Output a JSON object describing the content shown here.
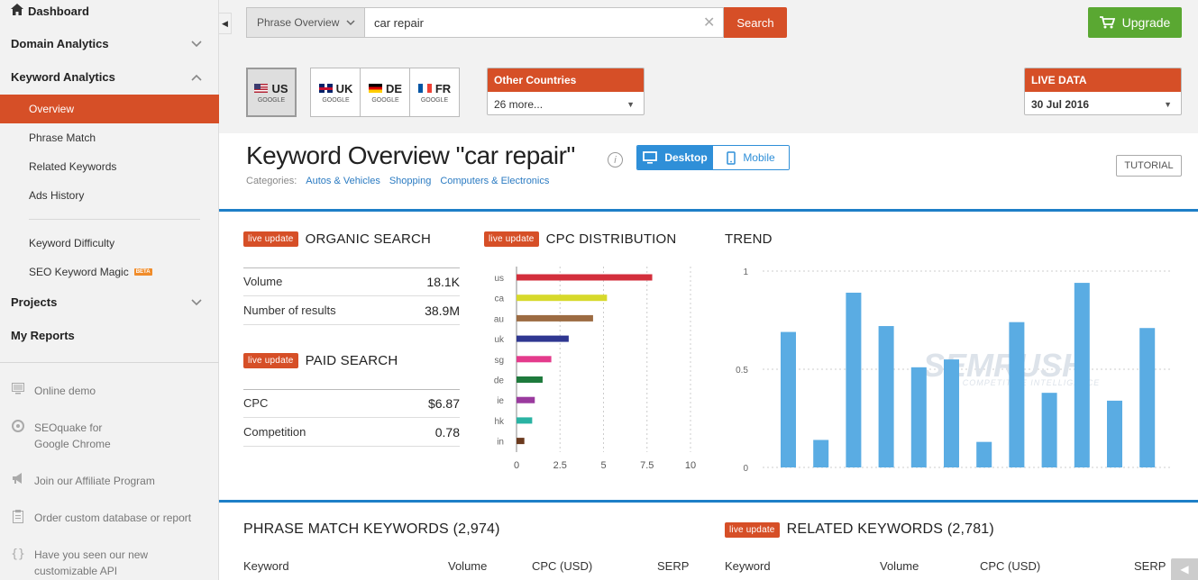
{
  "sidebar": {
    "dashboard": "Dashboard",
    "sections": [
      {
        "label": "Domain Analytics",
        "chevron": "down"
      },
      {
        "label": "Keyword Analytics",
        "chevron": "up"
      },
      {
        "label": "Projects",
        "chevron": "down"
      },
      {
        "label": "My Reports",
        "chevron": ""
      }
    ],
    "items": [
      "Overview",
      "Phrase Match",
      "Related Keywords",
      "Ads History",
      "Keyword Difficulty",
      "SEO Keyword Magic"
    ],
    "beta_badge": "BETA",
    "links": [
      {
        "label": "Online demo",
        "icon": "monitor-icon"
      },
      {
        "label": "SEOquake for Google Chrome",
        "icon": "seoquake-icon"
      },
      {
        "label": "Join our Affiliate Program",
        "icon": "megaphone-icon"
      },
      {
        "label": "Order custom database or report",
        "icon": "clipboard-icon"
      },
      {
        "label": "Have you seen our new customizable API format?",
        "icon": "braces-icon"
      }
    ]
  },
  "search": {
    "database_select": "Phrase Overview",
    "query": "car repair",
    "button": "Search"
  },
  "upgrade": "Upgrade",
  "countries": [
    {
      "code": "US",
      "engine": "GOOGLE",
      "flag": "us",
      "selected": true
    },
    {
      "code": "UK",
      "engine": "GOOGLE",
      "flag": "uk",
      "selected": false
    },
    {
      "code": "DE",
      "engine": "GOOGLE",
      "flag": "de",
      "selected": false
    },
    {
      "code": "FR",
      "engine": "GOOGLE",
      "flag": "fr",
      "selected": false
    }
  ],
  "other_countries": {
    "title": "Other Countries",
    "value": "26 more..."
  },
  "live_data": {
    "title": "LIVE DATA",
    "value": "30 Jul 2016"
  },
  "page": {
    "title": "Keyword Overview \"car repair\"",
    "categories_label": "Categories:",
    "categories": [
      "Autos & Vehicles",
      "Shopping",
      "Computers & Electronics"
    ],
    "device": {
      "desktop": "Desktop",
      "mobile": "Mobile",
      "active": "desktop"
    },
    "tutorial": "TUTORIAL"
  },
  "live_update": "live update",
  "organic": {
    "title": "ORGANIC SEARCH",
    "rows": [
      {
        "label": "Volume",
        "value": "18.1K"
      },
      {
        "label": "Number of results",
        "value": "38.9M"
      }
    ]
  },
  "paid": {
    "title": "PAID SEARCH",
    "rows": [
      {
        "label": "CPC",
        "value": "$6.87"
      },
      {
        "label": "Competition",
        "value": "0.78"
      }
    ]
  },
  "cpc_distribution": {
    "title": "CPC DISTRIBUTION"
  },
  "trend": {
    "title": "TREND",
    "watermark": "SEMRUSH",
    "watermark_sub": "COMPETITIVE INTELLIGENCE"
  },
  "phrase_match": {
    "title": "PHRASE MATCH KEYWORDS (2,974)",
    "columns": [
      "Keyword",
      "Volume",
      "CPC (USD)",
      "SERP"
    ]
  },
  "related": {
    "title": "RELATED KEYWORDS (2,781)",
    "columns": [
      "Keyword",
      "Volume",
      "CPC (USD)",
      "SERP"
    ]
  },
  "colors": {
    "accent": "#d64f27",
    "blue": "#1e7fc7",
    "green": "#5aa832",
    "trend_bar": "#5aace3"
  },
  "chart_data": [
    {
      "type": "bar",
      "orientation": "horizontal",
      "categories": [
        "us",
        "ca",
        "au",
        "uk",
        "sg",
        "de",
        "ie",
        "hk",
        "in"
      ],
      "values": [
        7.8,
        5.2,
        4.4,
        3.0,
        2.0,
        1.5,
        1.05,
        0.9,
        0.45
      ],
      "colors": [
        "#d32f3c",
        "#d7d92b",
        "#9c6b42",
        "#2f3791",
        "#e43b8c",
        "#1e7a3c",
        "#9a3a9e",
        "#2ab3a3",
        "#6b3a1e"
      ],
      "xlim": [
        0,
        10
      ],
      "xticks": [
        "0",
        "2.5",
        "5",
        "7.5",
        "10"
      ],
      "title": "CPC DISTRIBUTION"
    },
    {
      "type": "bar",
      "values": [
        0.69,
        0.14,
        0.89,
        0.72,
        0.51,
        0.55,
        0.13,
        0.74,
        0.38,
        0.94,
        0.34,
        0.71
      ],
      "ylim": [
        0,
        1
      ],
      "yticks": [
        "0",
        "0.5",
        "1"
      ],
      "title": "TREND",
      "grid": true
    }
  ]
}
